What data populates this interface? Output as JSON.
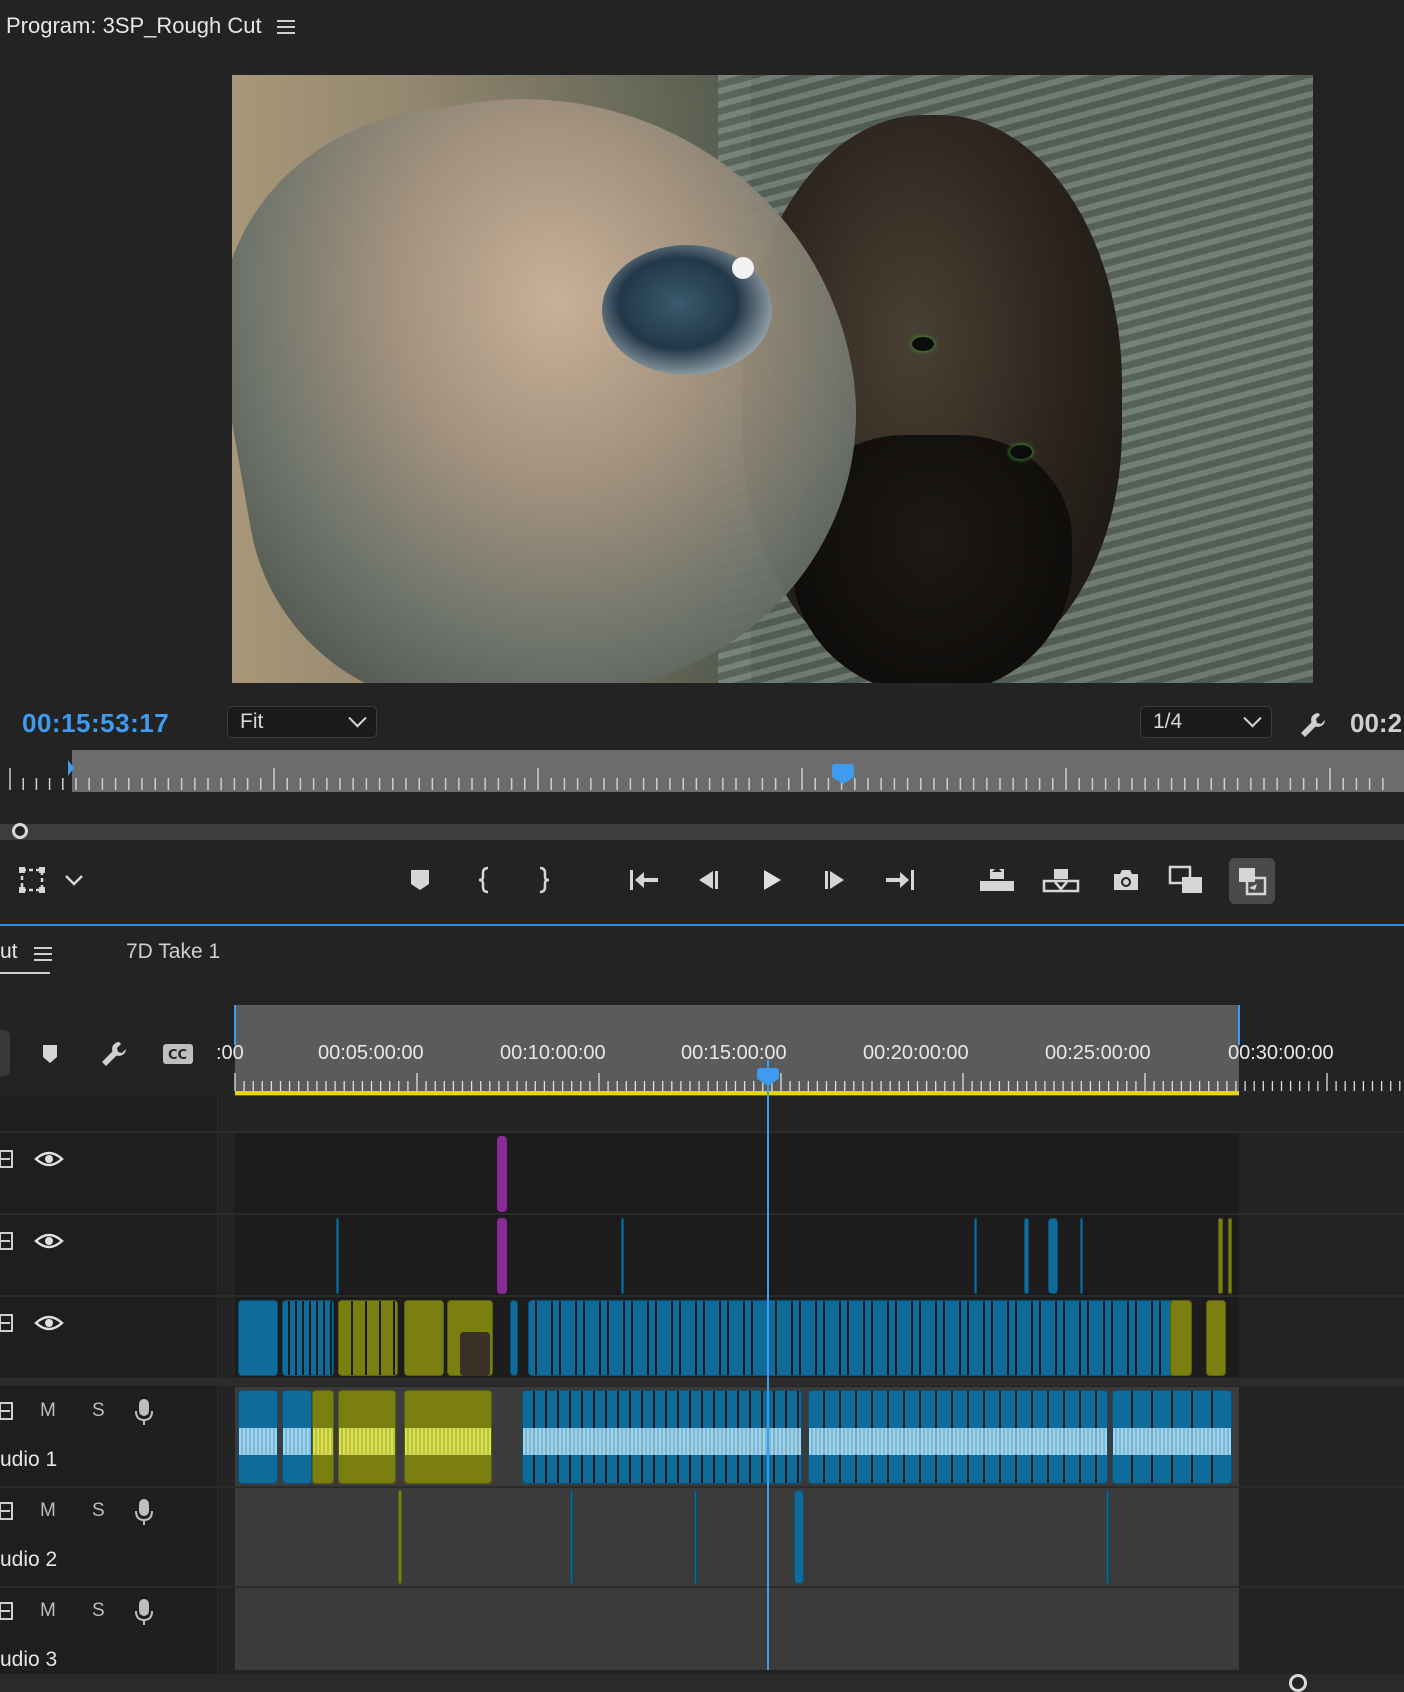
{
  "program": {
    "title": "Program: 3SP_Rough Cut",
    "timecode_current": "00:15:53:17",
    "zoom": "Fit",
    "resolution": "1/4",
    "timecode_duration_partial": "00:2"
  },
  "timeline": {
    "active_tab_partial": "ut",
    "second_tab": "7D Take 1",
    "ruler_labels": [
      ":00",
      "00:05:00:00",
      "00:10:00:00",
      "00:15:00:00",
      "00:20:00:00",
      "00:25:00:00",
      "00:30:00:00"
    ],
    "playhead_position": "00:15:53:17",
    "tracks": {
      "v3": {
        "type": "video"
      },
      "v2": {
        "type": "video"
      },
      "v1": {
        "type": "video"
      },
      "a1": {
        "label": "udio 1",
        "mute": "M",
        "solo": "S"
      },
      "a2": {
        "label": "udio 2",
        "mute": "M",
        "solo": "S"
      },
      "a3": {
        "label": "udio 3",
        "mute": "M",
        "solo": "S"
      }
    }
  },
  "colors": {
    "accent_blue": "#3f9bf0",
    "clip_video": "#0f6b9a",
    "clip_yellow": "#7b7f10",
    "clip_purple": "#8a2a96",
    "workarea": "#e5d41a"
  },
  "icons": [
    "hamburger-menu-icon",
    "wrench-icon",
    "chevron-down-icon",
    "safe-margins-icon",
    "marker-icon",
    "mark-in-icon",
    "mark-out-icon",
    "go-to-in-icon",
    "step-back-icon",
    "play-icon",
    "step-forward-icon",
    "go-to-out-icon",
    "lift-icon",
    "extract-icon",
    "camera-icon",
    "comparison-view-icon",
    "proxy-toggle-icon",
    "snap-icon",
    "closed-caption-icon",
    "eye-icon",
    "microphone-icon",
    "track-output-icon"
  ]
}
